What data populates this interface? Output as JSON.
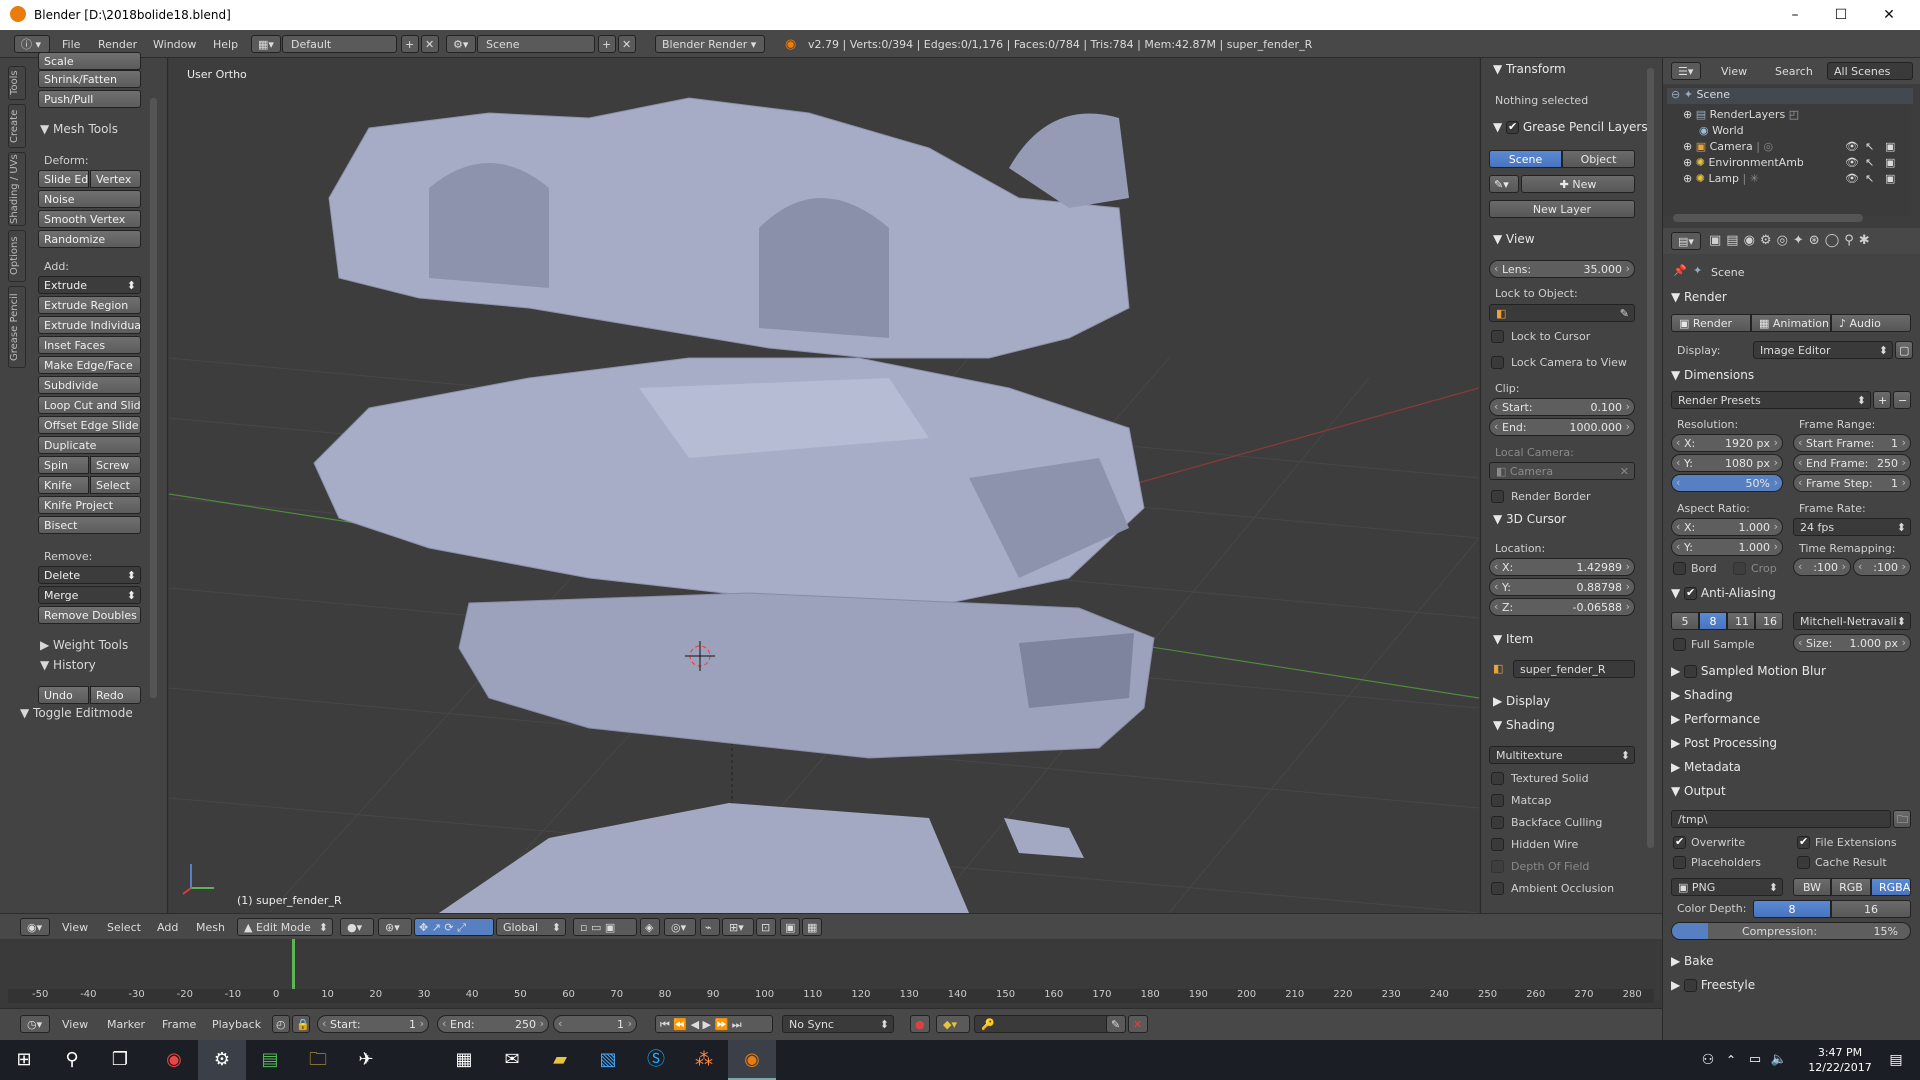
{
  "window": {
    "title": "Blender [D:\\2018bolide18.blend]",
    "min": "–",
    "max": "☐",
    "close": "✕"
  },
  "topbar": {
    "menus": [
      "File",
      "Render",
      "Window",
      "Help"
    ],
    "screen_layout": "Default",
    "scene": "Scene",
    "engine": "Blender Render",
    "stats": "v2.79 | Verts:0/394 | Edges:0/1,176 | Faces:0/784 | Tris:784 | Mem:42.87M | super_fender_R"
  },
  "toolshelf": {
    "tabs": [
      "Tools",
      "Create",
      "Shading / UVs",
      "Options",
      "Grease Pencil"
    ],
    "top_items": [
      "Scale",
      "Shrink/Fatten",
      "Push/Pull"
    ],
    "mesh_tools_header": "Mesh Tools",
    "deform_label": "Deform:",
    "deform_pair": [
      "Slide Ed",
      "Vertex"
    ],
    "deform_items": [
      "Noise",
      "Smooth Vertex",
      "Randomize"
    ],
    "add_label": "Add:",
    "extrude_dropdown": "Extrude",
    "add_items": [
      "Extrude Region",
      "Extrude Individual",
      "Inset Faces",
      "Make Edge/Face",
      "Subdivide",
      "Loop Cut and Slide",
      "Offset Edge Slide",
      "Duplicate"
    ],
    "pair1": [
      "Spin",
      "Screw"
    ],
    "pair2": [
      "Knife",
      "Select"
    ],
    "add_items2": [
      "Knife Project",
      "Bisect"
    ],
    "remove_label": "Remove:",
    "delete_dropdown": "Delete",
    "merge_dropdown": "Merge",
    "remove_doubles": "Remove Doubles",
    "weight_tools": "Weight Tools",
    "history": "History",
    "undo": "Undo",
    "redo": "Redo",
    "toggle_editmode": "Toggle Editmode"
  },
  "viewport": {
    "view_label": "User Ortho",
    "object_label": "(1) super_fender_R",
    "header": {
      "menus": [
        "View",
        "Select",
        "Add",
        "Mesh"
      ],
      "mode": "Edit Mode",
      "orientation": "Global"
    }
  },
  "npanel": {
    "transform": "Transform",
    "nothing_selected": "Nothing selected",
    "grease_pencil": "Grease Pencil Layers",
    "gp_tabs": [
      "Scene",
      "Object"
    ],
    "gp_new": "New",
    "gp_new_layer": "New Layer",
    "view": "View",
    "lens_label": "Lens:",
    "lens_value": "35.000",
    "lock_to_object": "Lock to Object:",
    "lock_to_cursor": "Lock to Cursor",
    "lock_camera": "Lock Camera to View",
    "clip": "Clip:",
    "clip_start_label": "Start:",
    "clip_start": "0.100",
    "clip_end_label": "End:",
    "clip_end": "1000.000",
    "local_camera": "Local Camera:",
    "camera_field": "Camera",
    "render_border": "Render Border",
    "cursor_header": "3D Cursor",
    "location": "Location:",
    "cursor_x": "1.42989",
    "cursor_y": "0.88798",
    "cursor_z": "-0.06588",
    "item": "Item",
    "item_name": "super_fender_R",
    "display": "Display",
    "shading": "Shading",
    "shading_mode": "Multitexture",
    "shading_options": [
      "Textured Solid",
      "Matcap",
      "Backface Culling",
      "Hidden Wire",
      "Depth Of Field",
      "Ambient Occlusion"
    ]
  },
  "outliner": {
    "menus": [
      "View",
      "Search"
    ],
    "filter": "All Scenes",
    "items": [
      "Scene",
      "RenderLayers",
      "World",
      "Camera",
      "EnvironmentAmbientLi",
      "Lamp"
    ]
  },
  "properties": {
    "context": "Scene",
    "render_header": "Render",
    "render_buttons": [
      "Render",
      "Animation",
      "Audio"
    ],
    "display_label": "Display:",
    "display_value": "Image Editor",
    "dimensions": "Dimensions",
    "render_presets": "Render Presets",
    "resolution": "Resolution:",
    "res_x": "1920 px",
    "res_y": "1080 px",
    "res_pct": "50%",
    "frame_range": "Frame Range:",
    "start_frame": "1",
    "end_frame": "250",
    "frame_step": "1",
    "aspect_ratio": "Aspect Ratio:",
    "aspect_x": "1.000",
    "aspect_y": "1.000",
    "frame_rate": "Frame Rate:",
    "fps": "24 fps",
    "time_remapping": "Time Remapping:",
    "remap_old": ":100",
    "remap_new": ":100",
    "bord": "Bord",
    "crop": "Crop",
    "anti_aliasing": "Anti-Aliasing",
    "aa_samples": [
      "5",
      "8",
      "11",
      "16"
    ],
    "aa_filter": "Mitchell-Netravali",
    "full_sample": "Full Sample",
    "size_label": "Size:",
    "size_value": "1.000 px",
    "collapsed": [
      "Sampled Motion Blur",
      "Shading",
      "Performance",
      "Post Processing",
      "Metadata"
    ],
    "output": "Output",
    "output_path": "/tmp\\",
    "overwrite": "Overwrite",
    "file_extensions": "File Extensions",
    "placeholders": "Placeholders",
    "cache_result": "Cache Result",
    "format": "PNG",
    "color_modes": [
      "BW",
      "RGB",
      "RGBA"
    ],
    "color_depth_label": "Color Depth:",
    "color_depth": [
      "8",
      "16"
    ],
    "compression_label": "Compression:",
    "compression": "15%",
    "compression_fraction": 0.15,
    "bake": "Bake",
    "freestyle": "Freestyle"
  },
  "timeline": {
    "ticks": [
      "-50",
      "-40",
      "-30",
      "-20",
      "-10",
      "0",
      "10",
      "20",
      "30",
      "40",
      "50",
      "60",
      "70",
      "80",
      "90",
      "100",
      "110",
      "120",
      "130",
      "140",
      "150",
      "160",
      "170",
      "180",
      "190",
      "200",
      "210",
      "220",
      "230",
      "240",
      "250",
      "260",
      "270",
      "280"
    ],
    "menus": [
      "View",
      "Marker",
      "Frame",
      "Playback"
    ],
    "start_label": "Start:",
    "start": "1",
    "end_label": "End:",
    "end": "250",
    "current": "1",
    "sync": "No Sync"
  },
  "taskbar": {
    "time": "3:47 PM",
    "date": "12/22/2017"
  },
  "colors": {
    "accent": "#5680c2",
    "bg": "#393939",
    "mesh": "#a8aec8",
    "playhead": "#5ab552"
  }
}
